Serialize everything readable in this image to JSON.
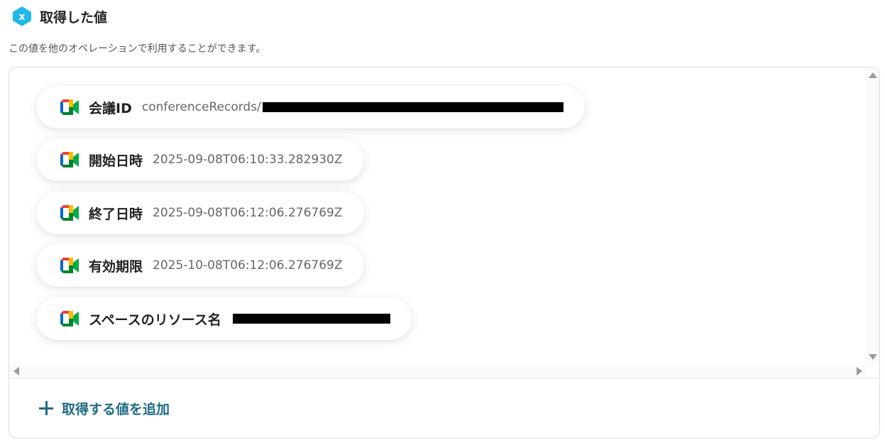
{
  "header": {
    "icon": "variable-x-icon",
    "title": "取得した値"
  },
  "subtitle": "この値を他のオペレーションで利用することができます。",
  "values": [
    {
      "icon": "google-meet-icon",
      "label": "会議ID",
      "value": "conferenceRecords/",
      "redacted": true
    },
    {
      "icon": "google-meet-icon",
      "label": "開始日時",
      "value": "2025-09-08T06:10:33.282930Z",
      "redacted": false
    },
    {
      "icon": "google-meet-icon",
      "label": "終了日時",
      "value": "2025-09-08T06:12:06.276769Z",
      "redacted": false
    },
    {
      "icon": "google-meet-icon",
      "label": "有効期限",
      "value": "2025-10-08T06:12:06.276769Z",
      "redacted": false
    },
    {
      "icon": "google-meet-icon",
      "label": "スペースのリソース名",
      "value": "",
      "redacted": true
    }
  ],
  "add_button": {
    "icon": "plus-icon",
    "label": "取得する値を追加"
  },
  "colors": {
    "accent": "#1f6a82",
    "header_icon": "#20b8e6",
    "meet_green": "#00832d",
    "meet_blue": "#0066da",
    "meet_red": "#e94235",
    "meet_yellow": "#ffba00"
  }
}
